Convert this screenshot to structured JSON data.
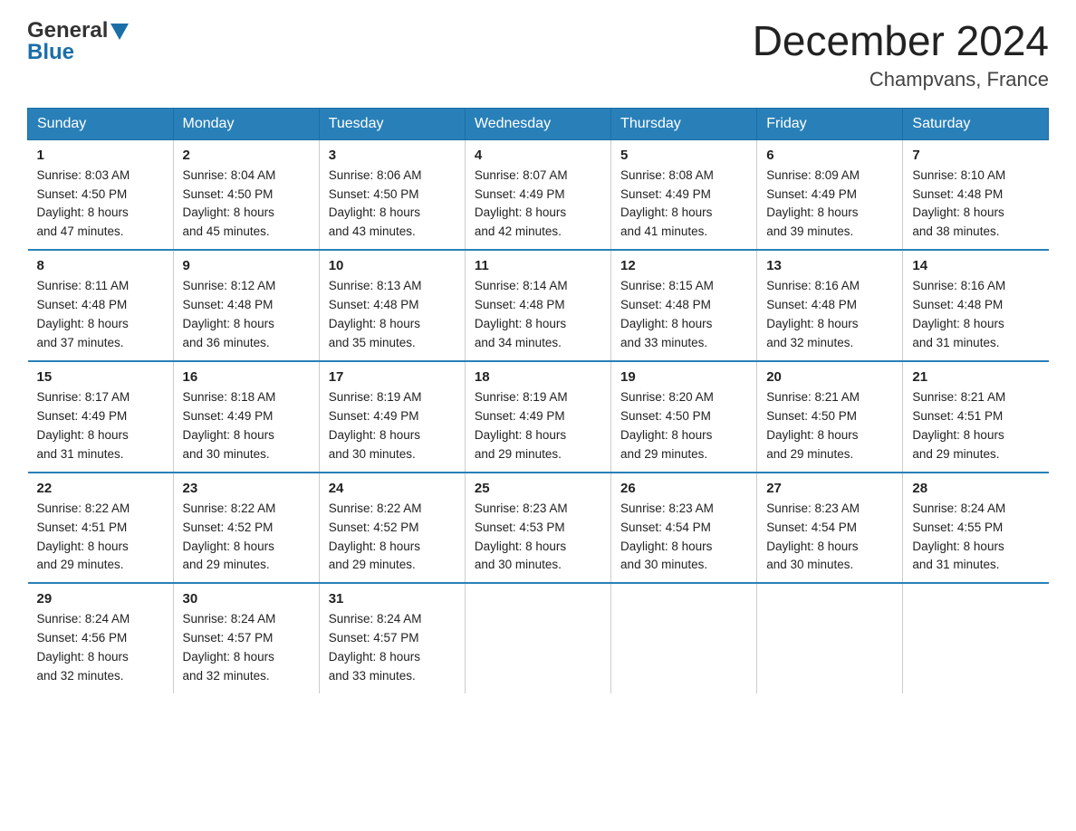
{
  "logo": {
    "part1": "General",
    "triangle": "▶",
    "part2": "Blue"
  },
  "title": "December 2024",
  "subtitle": "Champvans, France",
  "days_header": [
    "Sunday",
    "Monday",
    "Tuesday",
    "Wednesday",
    "Thursday",
    "Friday",
    "Saturday"
  ],
  "weeks": [
    [
      {
        "day": "1",
        "info": "Sunrise: 8:03 AM\nSunset: 4:50 PM\nDaylight: 8 hours\nand 47 minutes."
      },
      {
        "day": "2",
        "info": "Sunrise: 8:04 AM\nSunset: 4:50 PM\nDaylight: 8 hours\nand 45 minutes."
      },
      {
        "day": "3",
        "info": "Sunrise: 8:06 AM\nSunset: 4:50 PM\nDaylight: 8 hours\nand 43 minutes."
      },
      {
        "day": "4",
        "info": "Sunrise: 8:07 AM\nSunset: 4:49 PM\nDaylight: 8 hours\nand 42 minutes."
      },
      {
        "day": "5",
        "info": "Sunrise: 8:08 AM\nSunset: 4:49 PM\nDaylight: 8 hours\nand 41 minutes."
      },
      {
        "day": "6",
        "info": "Sunrise: 8:09 AM\nSunset: 4:49 PM\nDaylight: 8 hours\nand 39 minutes."
      },
      {
        "day": "7",
        "info": "Sunrise: 8:10 AM\nSunset: 4:48 PM\nDaylight: 8 hours\nand 38 minutes."
      }
    ],
    [
      {
        "day": "8",
        "info": "Sunrise: 8:11 AM\nSunset: 4:48 PM\nDaylight: 8 hours\nand 37 minutes."
      },
      {
        "day": "9",
        "info": "Sunrise: 8:12 AM\nSunset: 4:48 PM\nDaylight: 8 hours\nand 36 minutes."
      },
      {
        "day": "10",
        "info": "Sunrise: 8:13 AM\nSunset: 4:48 PM\nDaylight: 8 hours\nand 35 minutes."
      },
      {
        "day": "11",
        "info": "Sunrise: 8:14 AM\nSunset: 4:48 PM\nDaylight: 8 hours\nand 34 minutes."
      },
      {
        "day": "12",
        "info": "Sunrise: 8:15 AM\nSunset: 4:48 PM\nDaylight: 8 hours\nand 33 minutes."
      },
      {
        "day": "13",
        "info": "Sunrise: 8:16 AM\nSunset: 4:48 PM\nDaylight: 8 hours\nand 32 minutes."
      },
      {
        "day": "14",
        "info": "Sunrise: 8:16 AM\nSunset: 4:48 PM\nDaylight: 8 hours\nand 31 minutes."
      }
    ],
    [
      {
        "day": "15",
        "info": "Sunrise: 8:17 AM\nSunset: 4:49 PM\nDaylight: 8 hours\nand 31 minutes."
      },
      {
        "day": "16",
        "info": "Sunrise: 8:18 AM\nSunset: 4:49 PM\nDaylight: 8 hours\nand 30 minutes."
      },
      {
        "day": "17",
        "info": "Sunrise: 8:19 AM\nSunset: 4:49 PM\nDaylight: 8 hours\nand 30 minutes."
      },
      {
        "day": "18",
        "info": "Sunrise: 8:19 AM\nSunset: 4:49 PM\nDaylight: 8 hours\nand 29 minutes."
      },
      {
        "day": "19",
        "info": "Sunrise: 8:20 AM\nSunset: 4:50 PM\nDaylight: 8 hours\nand 29 minutes."
      },
      {
        "day": "20",
        "info": "Sunrise: 8:21 AM\nSunset: 4:50 PM\nDaylight: 8 hours\nand 29 minutes."
      },
      {
        "day": "21",
        "info": "Sunrise: 8:21 AM\nSunset: 4:51 PM\nDaylight: 8 hours\nand 29 minutes."
      }
    ],
    [
      {
        "day": "22",
        "info": "Sunrise: 8:22 AM\nSunset: 4:51 PM\nDaylight: 8 hours\nand 29 minutes."
      },
      {
        "day": "23",
        "info": "Sunrise: 8:22 AM\nSunset: 4:52 PM\nDaylight: 8 hours\nand 29 minutes."
      },
      {
        "day": "24",
        "info": "Sunrise: 8:22 AM\nSunset: 4:52 PM\nDaylight: 8 hours\nand 29 minutes."
      },
      {
        "day": "25",
        "info": "Sunrise: 8:23 AM\nSunset: 4:53 PM\nDaylight: 8 hours\nand 30 minutes."
      },
      {
        "day": "26",
        "info": "Sunrise: 8:23 AM\nSunset: 4:54 PM\nDaylight: 8 hours\nand 30 minutes."
      },
      {
        "day": "27",
        "info": "Sunrise: 8:23 AM\nSunset: 4:54 PM\nDaylight: 8 hours\nand 30 minutes."
      },
      {
        "day": "28",
        "info": "Sunrise: 8:24 AM\nSunset: 4:55 PM\nDaylight: 8 hours\nand 31 minutes."
      }
    ],
    [
      {
        "day": "29",
        "info": "Sunrise: 8:24 AM\nSunset: 4:56 PM\nDaylight: 8 hours\nand 32 minutes."
      },
      {
        "day": "30",
        "info": "Sunrise: 8:24 AM\nSunset: 4:57 PM\nDaylight: 8 hours\nand 32 minutes."
      },
      {
        "day": "31",
        "info": "Sunrise: 8:24 AM\nSunset: 4:57 PM\nDaylight: 8 hours\nand 33 minutes."
      },
      {
        "day": "",
        "info": ""
      },
      {
        "day": "",
        "info": ""
      },
      {
        "day": "",
        "info": ""
      },
      {
        "day": "",
        "info": ""
      }
    ]
  ]
}
